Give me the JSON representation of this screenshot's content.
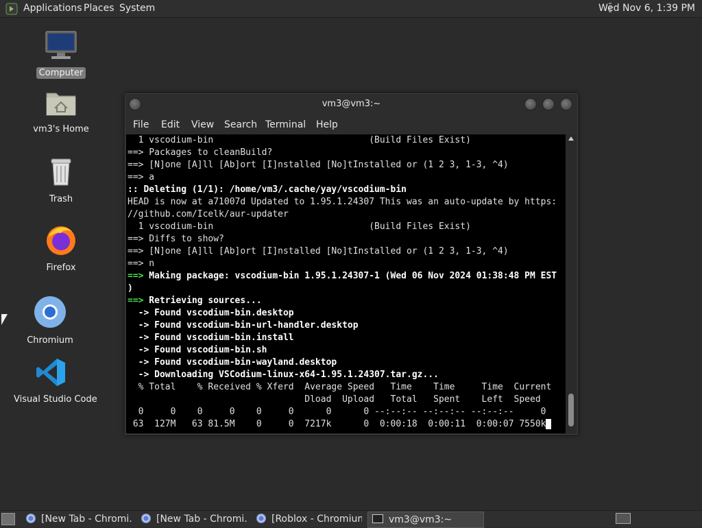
{
  "top_panel": {
    "menus": [
      "Applications",
      "Places",
      "System"
    ],
    "clock": "Wed Nov  6,  1:39 PM"
  },
  "desktop_icons": [
    {
      "label": "Computer"
    },
    {
      "label": "vm3's Home"
    },
    {
      "label": "Trash"
    },
    {
      "label": "Firefox"
    },
    {
      "label": "Chromium"
    },
    {
      "label": "Visual Studio Code"
    }
  ],
  "window": {
    "title": "vm3@vm3:~",
    "menu": [
      "File",
      "Edit",
      "View",
      "Search",
      "Terminal",
      "Help"
    ]
  },
  "terminal_lines": [
    {
      "text": "  1 vscodium-bin                             (Build Files Exist)",
      "style": ""
    },
    {
      "text": "==> Packages to cleanBuild?",
      "style": ""
    },
    {
      "text": "==> [N]one [A]ll [Ab]ort [I]nstalled [No]tInstalled or (1 2 3, 1-3, ^4)",
      "style": ""
    },
    {
      "text": "==> a",
      "style": ""
    },
    {
      "text": ":: Deleting (1/1): /home/vm3/.cache/yay/vscodium-bin",
      "style": "bold"
    },
    {
      "text": "HEAD is now at a71007d Updated to 1.95.1.24307 This was an auto-update by https:",
      "style": ""
    },
    {
      "text": "//github.com/Icelk/aur-updater",
      "style": ""
    },
    {
      "text": "  1 vscodium-bin                             (Build Files Exist)",
      "style": ""
    },
    {
      "text": "==> Diffs to show?",
      "style": ""
    },
    {
      "text": "==> [N]one [A]ll [Ab]ort [I]nstalled [No]tInstalled or (1 2 3, 1-3, ^4)",
      "style": ""
    },
    {
      "text": "==> n",
      "style": ""
    },
    {
      "text": "==> Making package: vscodium-bin 1.95.1.24307-1 (Wed 06 Nov 2024 01:38:48 PM EST",
      "style": "green-prefix"
    },
    {
      "text": ")",
      "style": "bold"
    },
    {
      "text": "==> Retrieving sources...",
      "style": "green-prefix"
    },
    {
      "text": "  -> Found vscodium-bin.desktop",
      "style": "bold"
    },
    {
      "text": "  -> Found vscodium-bin-url-handler.desktop",
      "style": "bold"
    },
    {
      "text": "  -> Found vscodium-bin.install",
      "style": "bold"
    },
    {
      "text": "  -> Found vscodium-bin.sh",
      "style": "bold"
    },
    {
      "text": "  -> Found vscodium-bin-wayland.desktop",
      "style": "bold"
    },
    {
      "text": "  -> Downloading VSCodium-linux-x64-1.95.1.24307.tar.gz...",
      "style": "bold"
    },
    {
      "text": "  % Total    % Received % Xferd  Average Speed   Time    Time     Time  Current",
      "style": ""
    },
    {
      "text": "                                 Dload  Upload   Total   Spent    Left  Speed",
      "style": ""
    },
    {
      "text": "  0     0    0     0    0     0      0      0 --:--:-- --:--:-- --:--:--     0",
      "style": ""
    },
    {
      "text": " 63  127M   63 81.5M    0     0  7217k      0  0:00:18  0:00:11  0:00:07 7550k",
      "style": "cursor"
    }
  ],
  "taskbar": [
    {
      "label": "[New Tab - Chromi...",
      "icon": "chromium-icon"
    },
    {
      "label": "[New Tab - Chromi...",
      "icon": "chromium-icon"
    },
    {
      "label": "[Roblox - Chromium]",
      "icon": "chromium-icon"
    },
    {
      "label": "vm3@vm3:~",
      "icon": "terminal-icon",
      "active": true
    }
  ],
  "colors": {
    "panel": "#2f2f2f",
    "desktop": "#2b2b2b",
    "terminal_bg": "#000000",
    "prompt_green": "#4fe04f"
  }
}
